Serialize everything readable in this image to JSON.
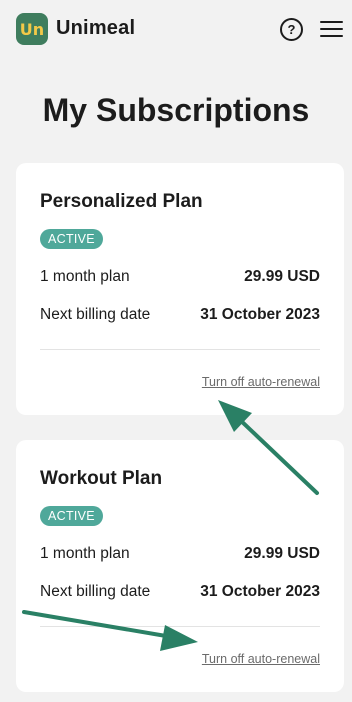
{
  "header": {
    "logo_mark": "Un",
    "app_name": "Unimeal",
    "help_label": "?"
  },
  "page_title": "My Subscriptions",
  "subscriptions": [
    {
      "title": "Personalized Plan",
      "status": "ACTIVE",
      "plan_label": "1 month plan",
      "price": "29.99 USD",
      "billing_label": "Next billing date",
      "billing_date": "31 October 2023",
      "renewal_link": "Turn off auto-renewal"
    },
    {
      "title": "Workout Plan",
      "status": "ACTIVE",
      "plan_label": "1 month plan",
      "price": "29.99 USD",
      "billing_label": "Next billing date",
      "billing_date": "31 October 2023",
      "renewal_link": "Turn off auto-renewal"
    }
  ],
  "colors": {
    "brand_green": "#4fa89a",
    "logo_bg": "#3f7d5e",
    "logo_accent": "#f3c948",
    "arrow": "#2a8065",
    "background": "#f2f2f2"
  },
  "icons": {
    "help": "help-circle-icon",
    "menu": "hamburger-menu-icon"
  }
}
